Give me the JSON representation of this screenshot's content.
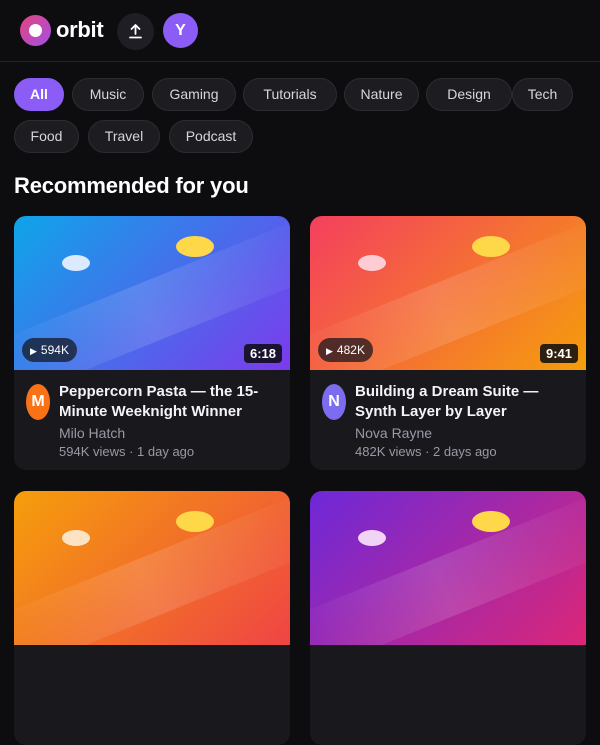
{
  "header": {
    "logo_text": "orbit",
    "avatar_initial": "Y",
    "icons": {
      "upload": "upload-icon",
      "logo": "orbit-logo-icon"
    }
  },
  "chips": [
    "All",
    "Music",
    "Gaming",
    "Tutorials",
    "Nature",
    "Design",
    "Tech",
    "Food",
    "Travel",
    "Podcast"
  ],
  "active_chip": "All",
  "section_title": "Recommended for you",
  "colors": {
    "accent": "#8b5cf6",
    "background": "#0d0d10",
    "card": "#18181d"
  },
  "videos": [
    {
      "title": "Peppercorn Pasta — the 15-Minute Weeknight Winner",
      "channel": "Milo Hatch",
      "stats": "594K views · 1 day ago",
      "views_badge": "594K",
      "duration": "6:18",
      "channel_initial": "M",
      "avatar_color": "#f97316",
      "thumb_gradient": [
        "#0ea5e9",
        "#7c3aed"
      ],
      "cloud_color": "#dbeafe"
    },
    {
      "title": "Building a Dream Suite — Synth Layer by Layer",
      "channel": "Nova Rayne",
      "stats": "482K views · 2 days ago",
      "views_badge": "482K",
      "duration": "9:41",
      "channel_initial": "N",
      "avatar_color": "#7c6cf0",
      "thumb_gradient": [
        "#f43f5e",
        "#f59e0b"
      ],
      "cloud_color": "#fecdd3"
    },
    {
      "title": "",
      "channel": "",
      "stats": "",
      "views_badge": "",
      "duration": "",
      "channel_initial": "",
      "avatar_color": "#f97316",
      "thumb_gradient": [
        "#f59e0b",
        "#ef4444"
      ],
      "cloud_color": "#fde2c4"
    },
    {
      "title": "",
      "channel": "",
      "stats": "",
      "views_badge": "",
      "duration": "",
      "channel_initial": "",
      "avatar_color": "#7c6cf0",
      "thumb_gradient": [
        "#6d28d9",
        "#db2777"
      ],
      "cloud_color": "#f0d4f5"
    }
  ]
}
